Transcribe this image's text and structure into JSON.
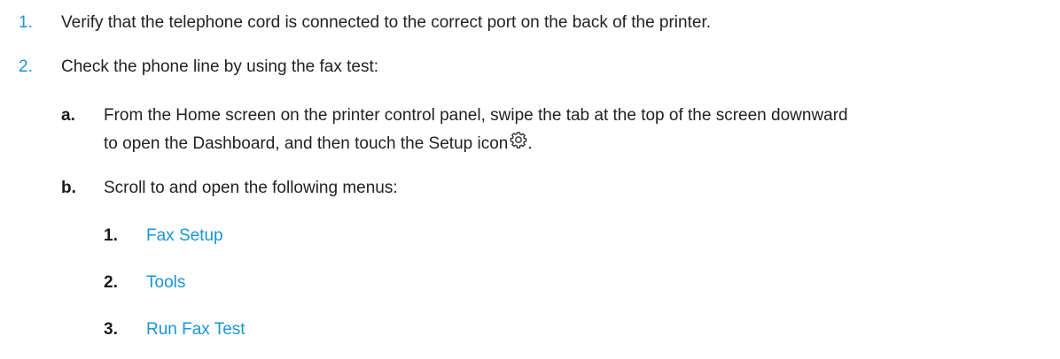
{
  "steps": [
    {
      "number": "1.",
      "text": "Verify that the telephone cord is connected to the correct port on the back of the printer."
    },
    {
      "number": "2.",
      "text": "Check the phone line by using the fax test:"
    }
  ],
  "substeps": [
    {
      "letter": "a.",
      "line1": "From the Home screen on the printer control panel, swipe the tab at the top of the screen downward",
      "line2": "to open the Dashboard, and then touch the Setup icon",
      "line2_end": ".",
      "icon": "gear-icon"
    },
    {
      "letter": "b.",
      "text": "Scroll to and open the following menus:"
    }
  ],
  "menus": [
    {
      "number": "1.",
      "label": "Fax Setup"
    },
    {
      "number": "2.",
      "label": "Tools"
    },
    {
      "number": "3.",
      "label": "Run Fax Test"
    }
  ],
  "colors": {
    "accent": "#1a94d4",
    "text": "#222222"
  }
}
